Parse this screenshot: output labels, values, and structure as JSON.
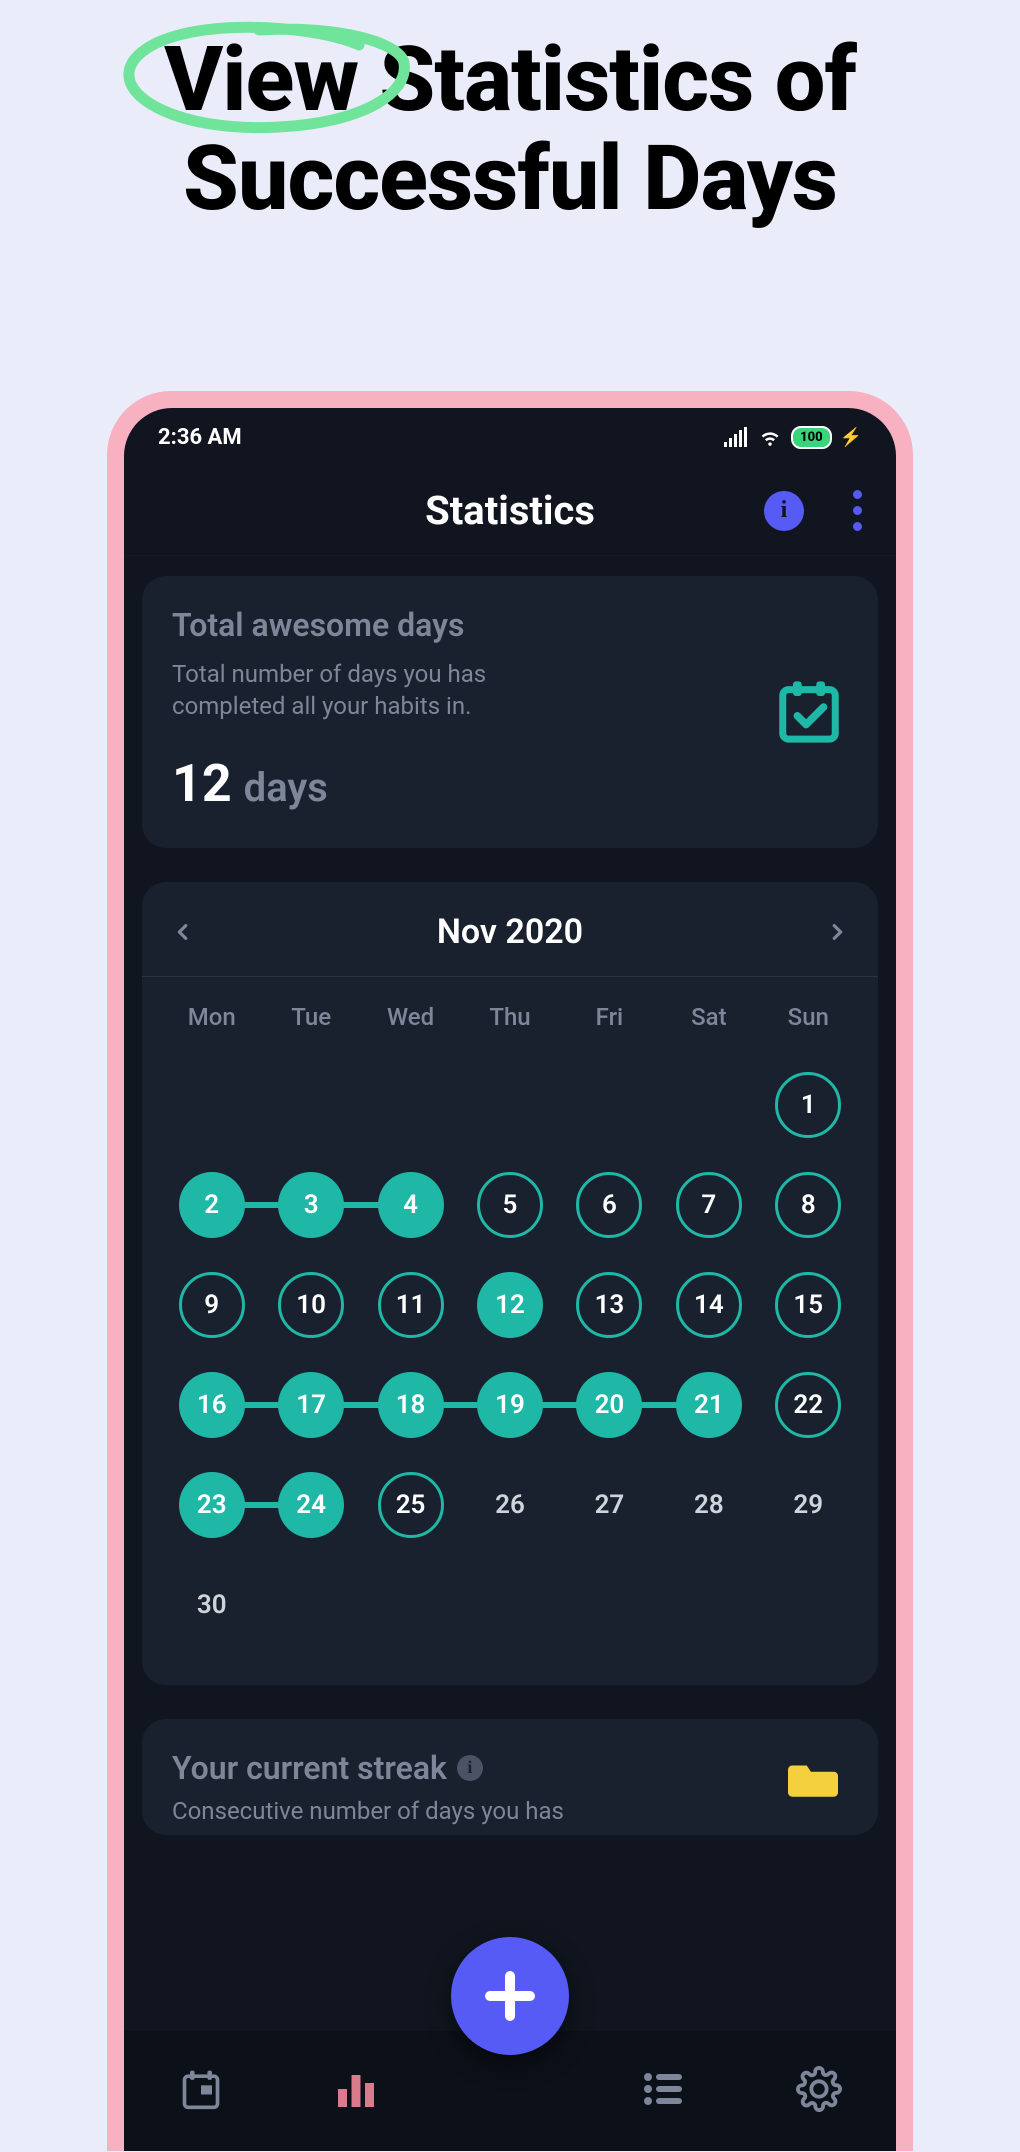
{
  "heading": {
    "circled_word": "View",
    "rest_line1": "Statistics of",
    "line2": "Successful Days"
  },
  "status": {
    "time": "2:36 AM",
    "battery": "100"
  },
  "appbar": {
    "title": "Statistics"
  },
  "total_card": {
    "title": "Total awesome days",
    "subtitle": "Total number of days you has completed all your habits in.",
    "value": "12",
    "unit": "days"
  },
  "calendar": {
    "month_label": "Nov 2020",
    "dow": [
      "Mon",
      "Tue",
      "Wed",
      "Thu",
      "Fri",
      "Sat",
      "Sun"
    ],
    "weeks": [
      [
        {
          "n": ""
        },
        {
          "n": ""
        },
        {
          "n": ""
        },
        {
          "n": ""
        },
        {
          "n": ""
        },
        {
          "n": ""
        },
        {
          "n": "1",
          "state": "outline"
        }
      ],
      [
        {
          "n": "2",
          "state": "filled",
          "connect_next": true
        },
        {
          "n": "3",
          "state": "filled",
          "connect_next": true
        },
        {
          "n": "4",
          "state": "filled"
        },
        {
          "n": "5",
          "state": "outline"
        },
        {
          "n": "6",
          "state": "outline"
        },
        {
          "n": "7",
          "state": "outline"
        },
        {
          "n": "8",
          "state": "outline"
        }
      ],
      [
        {
          "n": "9",
          "state": "outline"
        },
        {
          "n": "10",
          "state": "outline"
        },
        {
          "n": "11",
          "state": "outline"
        },
        {
          "n": "12",
          "state": "filled"
        },
        {
          "n": "13",
          "state": "outline"
        },
        {
          "n": "14",
          "state": "outline"
        },
        {
          "n": "15",
          "state": "outline"
        }
      ],
      [
        {
          "n": "16",
          "state": "filled",
          "connect_next": true
        },
        {
          "n": "17",
          "state": "filled",
          "connect_next": true
        },
        {
          "n": "18",
          "state": "filled",
          "connect_next": true
        },
        {
          "n": "19",
          "state": "filled",
          "connect_next": true
        },
        {
          "n": "20",
          "state": "filled",
          "connect_next": true
        },
        {
          "n": "21",
          "state": "filled"
        },
        {
          "n": "22",
          "state": "outline"
        }
      ],
      [
        {
          "n": "23",
          "state": "filled",
          "connect_next": true
        },
        {
          "n": "24",
          "state": "filled"
        },
        {
          "n": "25",
          "state": "outline"
        },
        {
          "n": "26",
          "state": "plain"
        },
        {
          "n": "27",
          "state": "plain"
        },
        {
          "n": "28",
          "state": "plain"
        },
        {
          "n": "29",
          "state": "plain"
        }
      ],
      [
        {
          "n": "30",
          "state": "plain"
        },
        {
          "n": ""
        },
        {
          "n": ""
        },
        {
          "n": ""
        },
        {
          "n": ""
        },
        {
          "n": ""
        },
        {
          "n": ""
        }
      ]
    ]
  },
  "streak_card": {
    "title": "Your current streak",
    "subtitle_visible": "Consecutive number of days you has"
  },
  "colors": {
    "accent_teal": "#1fb7a6",
    "accent_purple": "#575bf5",
    "accent_pink": "#d97b8a",
    "phone_frame": "#f7b1c1",
    "circle_green": "#6fe49a"
  }
}
